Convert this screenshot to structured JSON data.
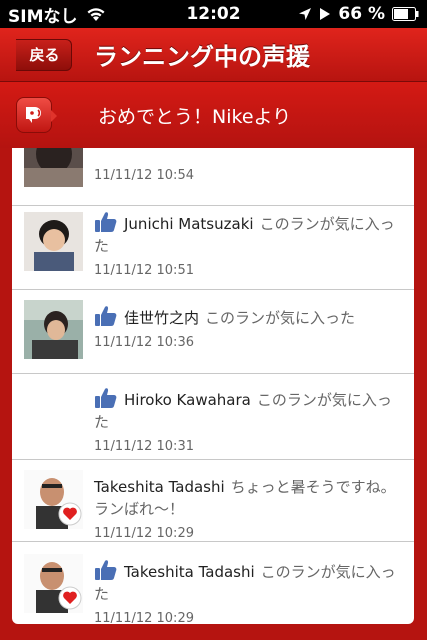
{
  "status_bar": {
    "carrier": "SIMなし",
    "time": "12:02",
    "battery": "66 %"
  },
  "nav": {
    "back_label": "戻る",
    "title": "ランニング中の声援"
  },
  "banner": {
    "message": "おめでとう！Nikeより"
  },
  "list": {
    "items": [
      {
        "user": "",
        "text": "",
        "liked": false,
        "timestamp": "11/11/12  10:54",
        "avatar": "photo"
      },
      {
        "user": "Junichi Matsuzaki",
        "text": "このランが気に入った",
        "liked": true,
        "timestamp": "11/11/12  10:51",
        "avatar": "photo"
      },
      {
        "user": "佳世竹之内",
        "text": "このランが気に入った",
        "liked": true,
        "timestamp": "11/11/12  10:36",
        "avatar": "photo"
      },
      {
        "user": "Hiroko Kawahara",
        "text": "このランが気に入った",
        "liked": true,
        "timestamp": "11/11/12  10:31",
        "avatar": "none"
      },
      {
        "user": "Takeshita Tadashi",
        "text": "ちょっと暑そうですね。ランばれ〜！",
        "liked": false,
        "timestamp": "11/11/12  10:29",
        "avatar": "photo-heart"
      },
      {
        "user": "Takeshita Tadashi",
        "text": "このランが気に入った",
        "liked": true,
        "timestamp": "11/11/12  10:29",
        "avatar": "photo-heart"
      }
    ]
  },
  "colors": {
    "accent_red": "#c41a14",
    "like_blue": "#4a6fb5"
  },
  "icons": {
    "like": "thumbs-up-icon",
    "cheer": "speaker-icon",
    "wifi": "wifi-icon",
    "battery": "battery-icon",
    "location": "location-arrow-icon",
    "play": "play-icon"
  }
}
